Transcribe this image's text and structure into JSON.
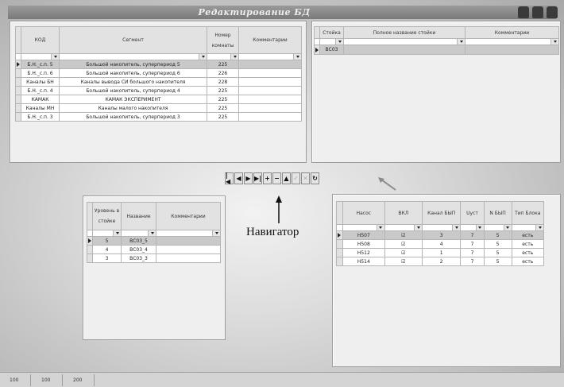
{
  "window": {
    "title": "Редактирование БД"
  },
  "segments_table": {
    "headers": [
      "КОД",
      "Сегмент",
      "Номер комнаты",
      "Комментарии"
    ],
    "rows": [
      [
        "Б.Н._с.п. 5",
        "Большой накопитель, суперпериод 5",
        "225",
        ""
      ],
      [
        "Б.Н._с.п. 6",
        "Большой накопитель, суперпериод 6",
        "226",
        ""
      ],
      [
        "Каналы БН",
        "Каналы вывода СИ большого накопителя",
        "228",
        ""
      ],
      [
        "Б.Н._с.п. 4",
        "Большой накопитель, суперпериод 4",
        "225",
        ""
      ],
      [
        "КАМАК",
        "КАМАК ЭКСПЕРИМЕНТ",
        "225",
        ""
      ],
      [
        "Каналы МН",
        "Каналы малого накопителя",
        "225",
        ""
      ],
      [
        "Б.Н._с.п. 3",
        "Большой накопитель, суперпериод 3",
        "225",
        ""
      ]
    ],
    "selected_row": 0
  },
  "racks_table": {
    "headers": [
      "Стойка",
      "Полное название стойки",
      "Комментарии"
    ],
    "rows": [
      [
        "ВС03",
        "",
        ""
      ]
    ],
    "selected_row": 0
  },
  "navigator": {
    "buttons": [
      {
        "name": "first",
        "glyph": "|◀",
        "enabled": true
      },
      {
        "name": "prior",
        "glyph": "◀",
        "enabled": true
      },
      {
        "name": "next",
        "glyph": "▶",
        "enabled": true
      },
      {
        "name": "last",
        "glyph": "▶|",
        "enabled": true
      },
      {
        "name": "insert",
        "glyph": "+",
        "enabled": true
      },
      {
        "name": "delete",
        "glyph": "−",
        "enabled": true
      },
      {
        "name": "edit",
        "glyph": "▲",
        "enabled": true
      },
      {
        "name": "post",
        "glyph": "✓",
        "enabled": false
      },
      {
        "name": "cancel",
        "glyph": "✕",
        "enabled": false
      },
      {
        "name": "refresh",
        "glyph": "↻",
        "enabled": true
      }
    ],
    "label": "Навигатор"
  },
  "levels_table": {
    "headers": [
      "Уровень в стойке",
      "Название",
      "Комментарии"
    ],
    "rows": [
      [
        "5",
        "ВС03_5",
        ""
      ],
      [
        "4",
        "ВС03_4",
        ""
      ],
      [
        "3",
        "ВС03_3",
        ""
      ]
    ],
    "selected_row": 0
  },
  "pumps_table": {
    "headers": [
      "Насос",
      "ВКЛ",
      "Канал БЫП",
      "Uуст",
      "N БЫП",
      "Тип Блока"
    ],
    "rows": [
      [
        "Н507",
        "☑",
        "3",
        "7",
        "5",
        "есть"
      ],
      [
        "Н508",
        "☑",
        "4",
        "7",
        "5",
        "есть"
      ],
      [
        "Н512",
        "☑",
        "1",
        "7",
        "5",
        "есть"
      ],
      [
        "Н514",
        "☑",
        "2",
        "7",
        "5",
        "есть"
      ]
    ],
    "selected_row": 0
  },
  "status_bar": {
    "panels": [
      "100",
      "100",
      "200"
    ]
  }
}
